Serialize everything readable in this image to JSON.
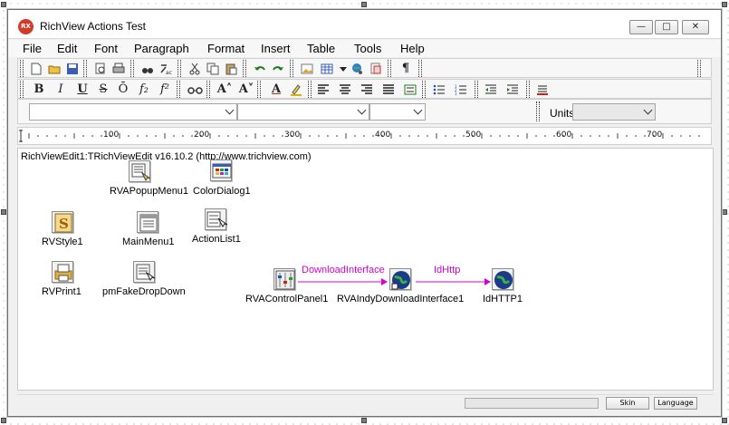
{
  "window": {
    "title": "RichView Actions Test",
    "app_icon_text": "RX",
    "controls": {
      "minimize": "—",
      "maximize": "□",
      "close": "✕"
    }
  },
  "menu": [
    "File",
    "Edit",
    "Font",
    "Paragraph",
    "Format",
    "Insert",
    "Table",
    "Tools",
    "Help"
  ],
  "toolbar2": {
    "bold": "B",
    "italic": "I",
    "underline": "U",
    "strike": "S",
    "overline": "Ō",
    "subscript": "f₂",
    "superscript": "f²",
    "grow_font": "A˄",
    "shrink_font": "A˅",
    "font_color": "A"
  },
  "toolbar1": {
    "pilcrow": "¶"
  },
  "combo_row": {
    "units_label": "Units:"
  },
  "ruler": {
    "labels": [
      "100",
      "200",
      "300",
      "400",
      "500",
      "600",
      "700"
    ]
  },
  "editor": {
    "text": "RichViewEdit1:TRichViewEdit v16.10.2 (http://www.trichview.com)",
    "components": {
      "popup_menu": "RVAPopupMenu1",
      "color_dialog": "ColorDialog1",
      "style": "RVStyle1",
      "main_menu": "MainMenu1",
      "action_list": "ActionList1",
      "print": "RVPrint1",
      "fake_dropdown": "pmFakeDropDown",
      "control_panel": "RVAControlPanel1",
      "download_interface": "RVAIndyDownloadInterface1",
      "http": "IdHTTP1"
    },
    "links": {
      "download_interface": "DownloadInterface",
      "idhttp": "IdHttp"
    },
    "link_color": "#d400d4"
  },
  "status": {
    "skin_label": "Skin",
    "language_label": "Language"
  }
}
